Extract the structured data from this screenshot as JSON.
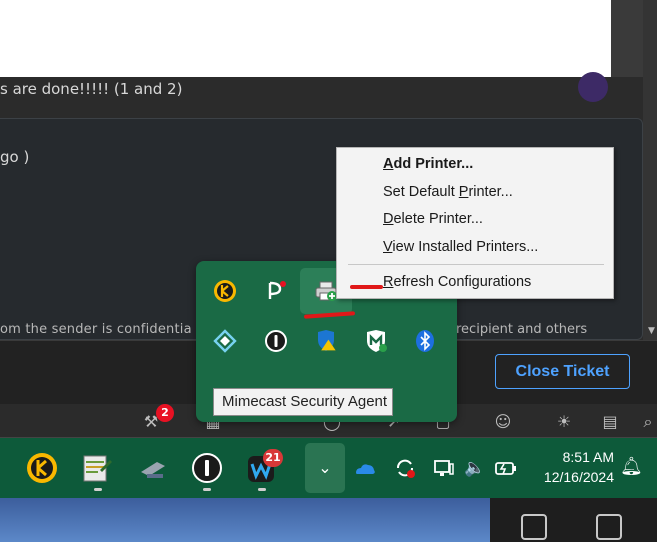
{
  "app": {
    "message_text": "s are done!!!!! (1 and 2)",
    "card_text": "go )",
    "confidential_left": "om the sender is confidentia",
    "confidential_right": "recipient and others",
    "close_ticket_label": "Close Ticket"
  },
  "icon_row": {
    "notification_badge": "2"
  },
  "context_menu": {
    "items": [
      {
        "accel": "A",
        "rest": "dd Printer..."
      },
      {
        "accel": "",
        "pre": "Set Default ",
        "accel2": "P",
        "rest": "rinter..."
      },
      {
        "accel": "D",
        "rest": "elete Printer..."
      },
      {
        "accel": "V",
        "rest": "iew Installed Printers..."
      },
      {
        "accel": "R",
        "rest": "efresh Configurations"
      }
    ]
  },
  "tray_popup": {
    "tooltip": "Mimecast Security Agent"
  },
  "taskbar": {
    "webex_badge": "21",
    "time": "8:51 AM",
    "date": "12/16/2024"
  },
  "colors": {
    "taskbar": "#0d5a3a",
    "popup": "#1a6a45",
    "accent_link": "#4ea2ff",
    "annotation": "#e01818"
  },
  "icons": [
    "keeper-icon",
    "notepad-icon",
    "usb-eject-icon",
    "onepassword-icon",
    "webex-icon",
    "chevron-up-icon",
    "onedrive-icon",
    "sync-icon",
    "display-icon",
    "volume-icon",
    "battery-icon",
    "bell-icon",
    "printer-icon",
    "bluetooth-icon",
    "defender-icon",
    "mimecast-icon"
  ]
}
